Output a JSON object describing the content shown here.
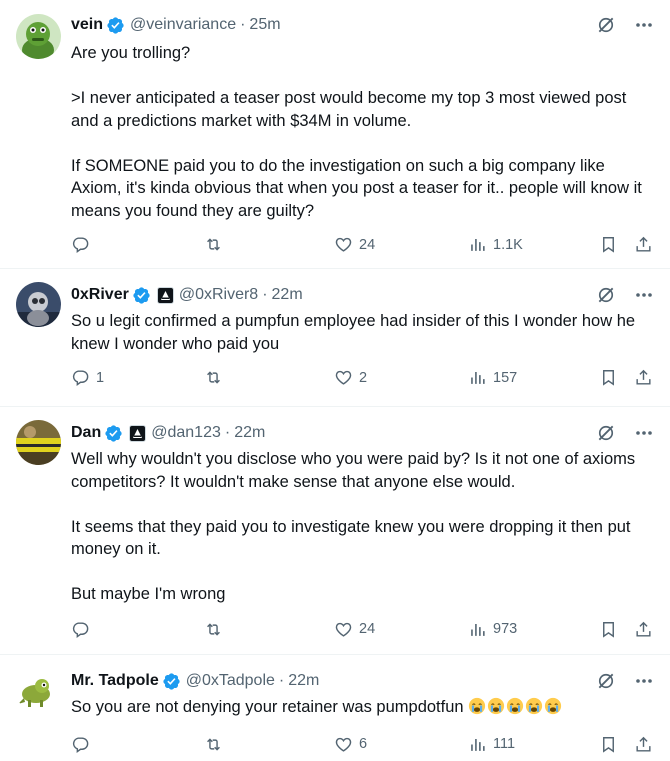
{
  "replies": [
    {
      "name": "vein",
      "handle": "@veinvariance",
      "time": "25m",
      "has_affiliate": false,
      "text": "Are you trolling?\n\n>I never anticipated a teaser post would become my top 3 most viewed post and a predictions market with $34M in volume.\n\nIf SOMEONE paid you to do the investigation on such a big company like Axiom, it's kinda obvious that when you post a teaser for it.. people will know it means you found they are guilty?",
      "replies": "",
      "reposts": "",
      "likes": "24",
      "views": "1.1K"
    },
    {
      "name": "0xRiver",
      "handle": "@0xRiver8",
      "time": "22m",
      "has_affiliate": true,
      "text": "So u legit confirmed a pumpfun employee had insider of this I wonder how he knew I wonder who paid you",
      "replies": "1",
      "reposts": "",
      "likes": "2",
      "views": "157"
    },
    {
      "name": "Dan",
      "handle": "@dan123",
      "time": "22m",
      "has_affiliate": true,
      "text": "Well why wouldn't you disclose who you were paid by? Is it not one of axioms competitors? It wouldn't make sense that anyone else would.\n\nIt seems that they paid you to investigate knew you were dropping it then put money on it.\n\nBut maybe I'm wrong",
      "replies": "",
      "reposts": "",
      "likes": "24",
      "views": "973"
    },
    {
      "name": "Mr. Tadpole",
      "handle": "@0xTadpole",
      "time": "22m",
      "has_affiliate": false,
      "text": "So you are not denying your retainer was pumpdotfun",
      "emoji_count": 5,
      "emoji_name": "loudly-crying-face",
      "replies": "",
      "reposts": "",
      "likes": "6",
      "views": "111"
    }
  ],
  "separator": "·",
  "colors": {
    "verified": "#1d9bf0",
    "muted": "#536471",
    "text": "#0f1419",
    "divider": "#eff3f4"
  }
}
